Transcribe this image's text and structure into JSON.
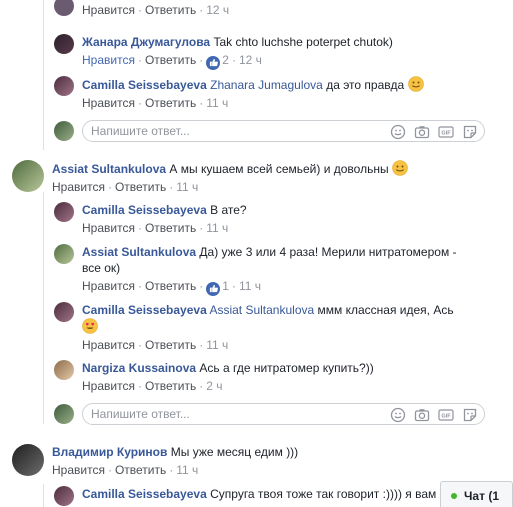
{
  "labels": {
    "like": "Нравится",
    "reply": "Ответить",
    "reply_placeholder": "Напишите ответ...",
    "sep": "·"
  },
  "comments": [
    {
      "time": "12 ч"
    },
    {
      "name": "Жанара Джумагулова",
      "text": "Tak chto luchshe poterpet chutok)",
      "time": "12 ч",
      "likes": "2"
    },
    {
      "name": "Camilla Seissebayeva",
      "mention": "Zhanara Jumagulova",
      "text": "да это правда",
      "time": "11 ч"
    },
    {
      "name": "Assiat Sultankulova",
      "text": "А мы кушаем всей семьей) и довольны",
      "time": "11 ч"
    },
    {
      "name": "Camilla Seissebayeva",
      "text": "В ате?",
      "time": "11 ч"
    },
    {
      "name": "Assiat Sultankulova",
      "text": "Да) уже 3 или 4 раза! Мерили нитратомером -",
      "text2": "все ок)",
      "time": "11 ч",
      "likes": "1"
    },
    {
      "name": "Camilla Seissebayeva",
      "mention": "Assiat Sultankulova",
      "text": "ммм классная идея, Ась",
      "time": "11 ч"
    },
    {
      "name": "Nargiza Kussainova",
      "text": "Ась а где нитратомер купить?))",
      "time": "2 ч"
    },
    {
      "name": "Владимир Куринов",
      "text": "Мы уже месяц едим )))",
      "time": "11 ч"
    },
    {
      "name": "Camilla Seissebayeva",
      "text": "Супруга твоя тоже так говорит :)))) я вам ве"
    }
  ],
  "chat": {
    "label": "Чат (1"
  },
  "colors": {
    "link": "#385898",
    "meta": "#90949c",
    "like_blue": "#4267b2",
    "online": "#42b72a"
  }
}
